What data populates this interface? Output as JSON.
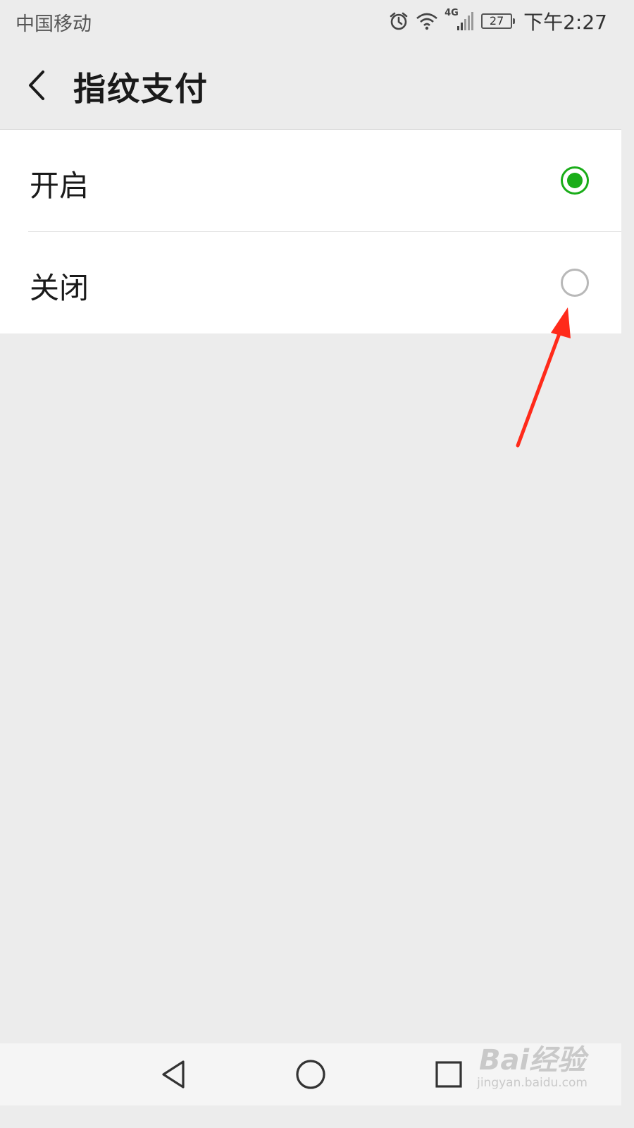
{
  "status_bar": {
    "carrier": "中国移动",
    "network_badge": "4G",
    "battery_level": "27",
    "time": "下午2:27",
    "icons": [
      "alarm-icon",
      "wifi-icon",
      "signal-icon",
      "battery-icon"
    ]
  },
  "nav": {
    "title": "指纹支付",
    "back_icon": "chevron-left-icon"
  },
  "options": [
    {
      "label": "开启",
      "selected": true
    },
    {
      "label": "关闭",
      "selected": false
    }
  ],
  "system_nav": [
    "back-triangle-icon",
    "home-circle-icon",
    "recents-square-icon"
  ],
  "watermark": {
    "logo": "Bai经验",
    "domain": "jingyan.baidu.com"
  },
  "colors": {
    "accent": "#1aad19",
    "annotation_arrow": "#ff2a1a",
    "background": "#ececec"
  }
}
